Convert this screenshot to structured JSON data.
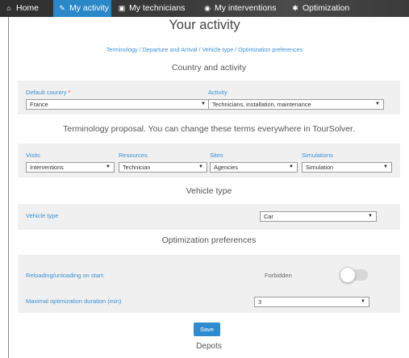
{
  "nav": {
    "items": [
      {
        "label": "Home",
        "icon": "home-icon"
      },
      {
        "label": "My activity",
        "icon": "pencil-icon"
      },
      {
        "label": "My technicians",
        "icon": "car-icon"
      },
      {
        "label": "My interventions",
        "icon": "map-marker-icon"
      },
      {
        "label": "Optimization",
        "icon": "gear-icon"
      }
    ],
    "active_color": "#2a87c8"
  },
  "page": {
    "title": "Your activity",
    "breadcrumb": [
      "Terminology",
      "Departure and Arrival",
      "Vehicle type",
      "Optimization preferences"
    ],
    "breadcrumb_sep": "/"
  },
  "country_activity": {
    "title": "Country and activity",
    "country_label": "Default country",
    "required_mark": "*",
    "country_value": "France",
    "activity_label": "Activity",
    "activity_value": "Technicians, installation, maintenance"
  },
  "terminology": {
    "title": "Terminology proposal. You can change these terms everywhere in TourSolver.",
    "fields": [
      {
        "label": "Visits",
        "value": "Interventions"
      },
      {
        "label": "Resources",
        "value": "Technician"
      },
      {
        "label": "Sites",
        "value": "Agencies"
      },
      {
        "label": "Simulations",
        "value": "Simulation"
      }
    ]
  },
  "vehicle": {
    "title": "Vehicle type",
    "label": "Vehicle type",
    "value": "Car"
  },
  "optimization": {
    "title": "Optimization preferences",
    "reload_label": "Reloading/unloading on start:",
    "reload_status": "Forbidden",
    "reload_enabled": false,
    "duration_label": "Maximal optimization duration (min)",
    "duration_value": "3"
  },
  "actions": {
    "save_label": "Save"
  },
  "depots": {
    "title": "Depots"
  },
  "colors": {
    "link": "#3b8fd1",
    "button": "#2f8bd0",
    "panel": "#f0f0f0",
    "required": "#e53935"
  }
}
